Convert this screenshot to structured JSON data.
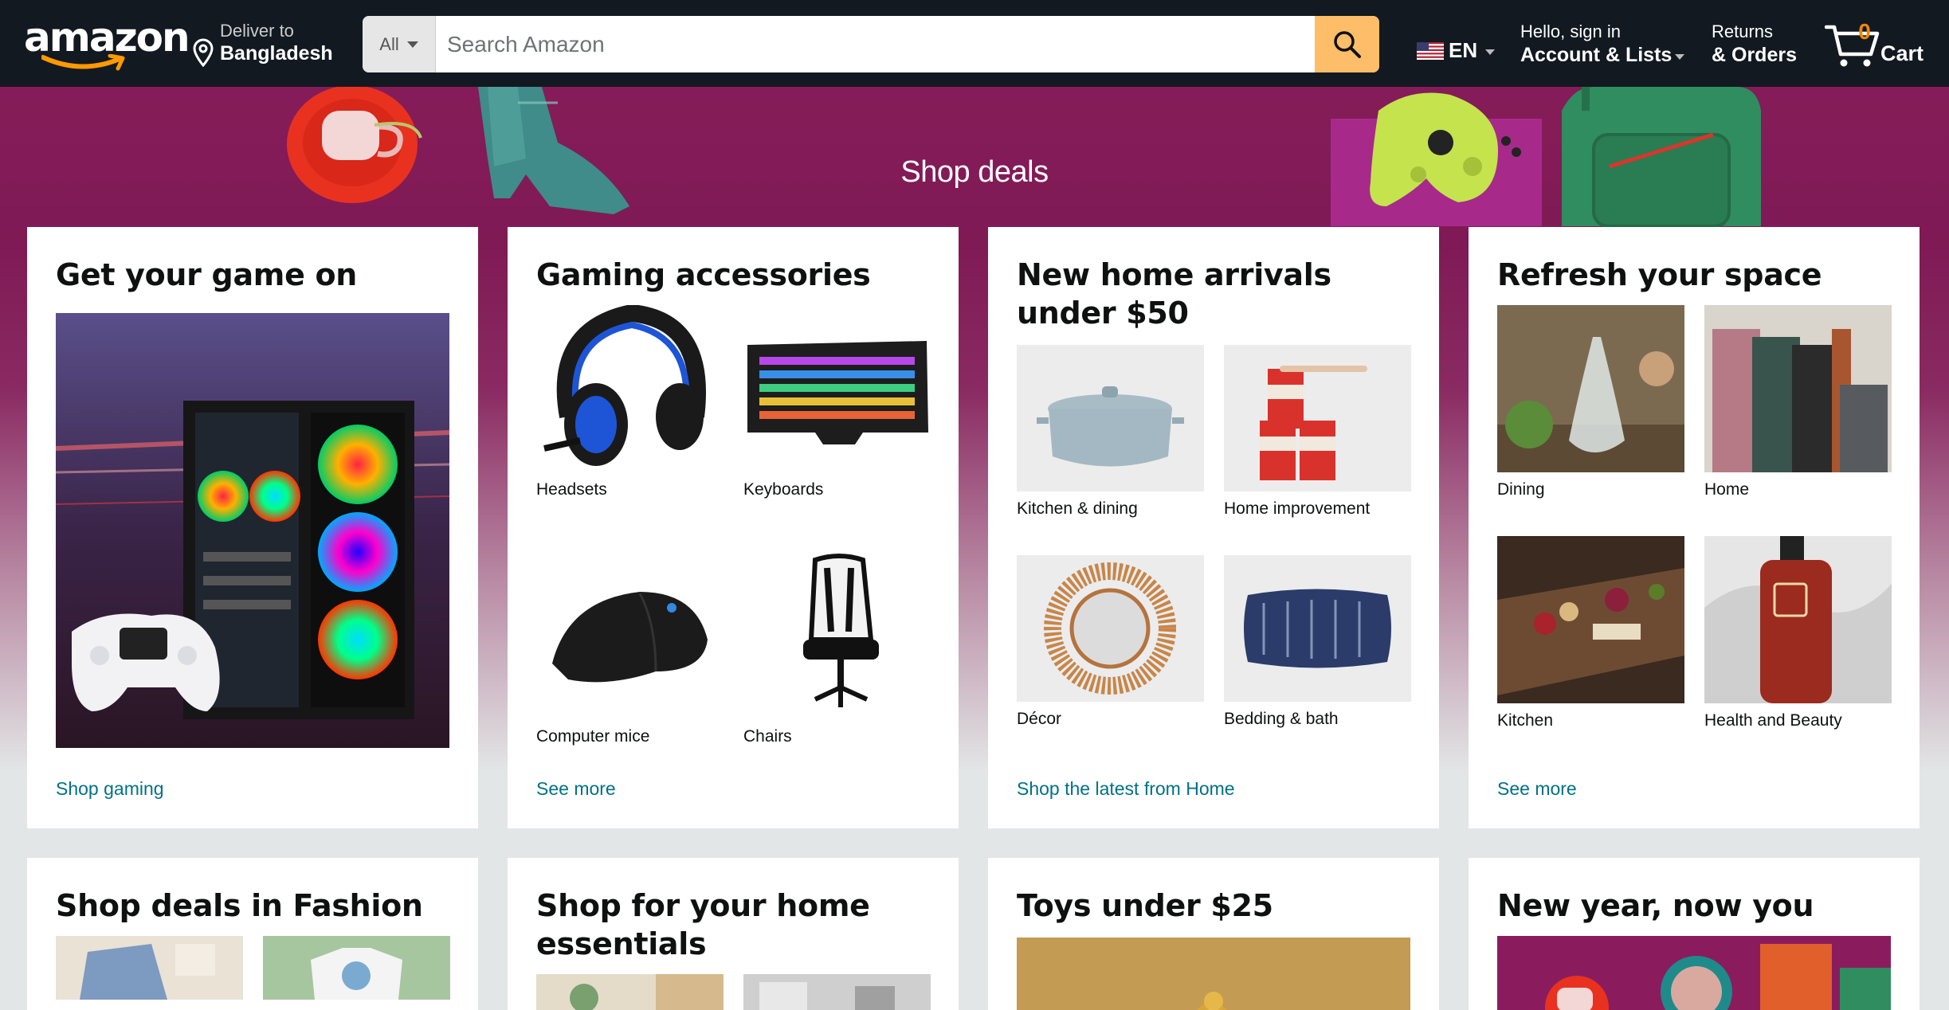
{
  "nav": {
    "logo": "amazon",
    "deliver_line1": "Deliver to",
    "deliver_line2": "Bangladesh",
    "search_category": "All",
    "search_placeholder": "Search Amazon",
    "language": "EN",
    "account_line1": "Hello, sign in",
    "account_line2": "Account & Lists",
    "returns_line1": "Returns",
    "returns_line2": "& Orders",
    "cart_count": "0",
    "cart_label": "Cart",
    "colors": {
      "bar": "#131921",
      "search_button": "#febd69",
      "cart_count": "#f08804"
    }
  },
  "hero": {
    "title": "Shop deals"
  },
  "cards": [
    {
      "title": "Get your game on",
      "link": "Shop gaming"
    },
    {
      "title": "Gaming accessories",
      "link": "See more",
      "tiles": [
        "Headsets",
        "Keyboards",
        "Computer mice",
        "Chairs"
      ]
    },
    {
      "title": "New home arrivals under $50",
      "link": "Shop the latest from Home",
      "tiles": [
        "Kitchen & dining",
        "Home improvement",
        "Décor",
        "Bedding & bath"
      ]
    },
    {
      "title": "Refresh your space",
      "link": "See more",
      "tiles": [
        "Dining",
        "Home",
        "Kitchen",
        "Health and Beauty"
      ]
    },
    {
      "title": "Shop deals in Fashion"
    },
    {
      "title": "Shop for your home essentials"
    },
    {
      "title": "Toys under $25"
    },
    {
      "title": "New year, now you"
    }
  ],
  "link_color": "#007185"
}
